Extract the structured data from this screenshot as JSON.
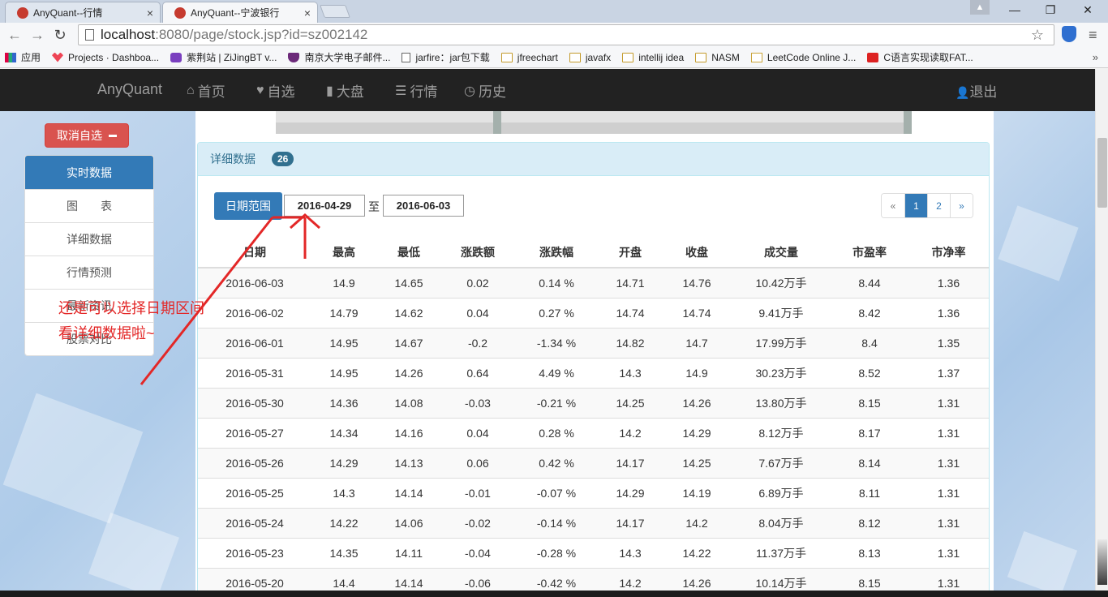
{
  "browser": {
    "tabs": [
      {
        "title": "AnyQuant--行情",
        "close": "×"
      },
      {
        "title": "AnyQuant--宁波银行",
        "close": "×"
      }
    ],
    "window_controls": {
      "minimize": "—",
      "restore": "❐",
      "close": "✕"
    },
    "nav": {
      "back": "←",
      "forward": "→",
      "reload": "↻"
    },
    "url_host": "localhost",
    "url_path": ":8080/page/stock.jsp?id=sz002142",
    "star": "☆",
    "menu": "≡",
    "bookmarks": [
      {
        "label": "应用",
        "icon": "grid"
      },
      {
        "label": "Projects · Dashboa...",
        "icon": "fox"
      },
      {
        "label": "紫荆站 | ZiJingBT v...",
        "icon": "purple"
      },
      {
        "label": "南京大学电子邮件...",
        "icon": "shield"
      },
      {
        "label": "jarfire：jar包下载",
        "icon": "doc"
      },
      {
        "label": "jfreechart",
        "icon": "folder"
      },
      {
        "label": "javafx",
        "icon": "folder"
      },
      {
        "label": "intellij idea",
        "icon": "folder"
      },
      {
        "label": "NASM",
        "icon": "folder"
      },
      {
        "label": "LeetCode Online J...",
        "icon": "lc"
      },
      {
        "label": "C语言实现读取FAT...",
        "icon": "red"
      }
    ],
    "bookmarks_more": "»"
  },
  "appnav": {
    "brand": "AnyQuant",
    "items": [
      {
        "icon": "⌂",
        "label": "首页"
      },
      {
        "icon": "♥",
        "label": "自选"
      },
      {
        "icon": "▮",
        "label": "大盘"
      },
      {
        "icon": "☰",
        "label": "行情"
      },
      {
        "icon": "◷",
        "label": "历史"
      }
    ],
    "logout_icon": "👤",
    "logout": "退出"
  },
  "sidebar": {
    "unfollow": "取消自选",
    "items": [
      "实时数据",
      "图　　表",
      "详细数据",
      "行情预测",
      "最新资讯",
      "股票对比"
    ]
  },
  "annotation": "还是可以选择日期区间看详细数据啦~",
  "panel": {
    "title": "详细数据",
    "badge": "26",
    "date_button": "日期范围",
    "date_from": "2016-04-29",
    "date_sep": "至",
    "date_to": "2016-06-03",
    "pager": {
      "prev": "«",
      "pages": [
        "1",
        "2"
      ],
      "active": "1",
      "next": "»"
    }
  },
  "table": {
    "columns": [
      "日期",
      "最高",
      "最低",
      "涨跌额",
      "涨跌幅",
      "开盘",
      "收盘",
      "成交量",
      "市盈率",
      "市净率"
    ],
    "rows": [
      {
        "date": "2016-06-03",
        "high": "14.9",
        "low": "14.65",
        "change": "0.02",
        "pct": "0.14 %",
        "open": "14.71",
        "close": "14.76",
        "volume": "10.42万手",
        "pe": "8.44",
        "pb": "1.36",
        "dir": "up"
      },
      {
        "date": "2016-06-02",
        "high": "14.79",
        "low": "14.62",
        "change": "0.04",
        "pct": "0.27 %",
        "open": "14.74",
        "close": "14.74",
        "volume": "9.41万手",
        "pe": "8.42",
        "pb": "1.36",
        "dir": "up"
      },
      {
        "date": "2016-06-01",
        "high": "14.95",
        "low": "14.67",
        "change": "-0.2",
        "pct": "-1.34 %",
        "open": "14.82",
        "close": "14.7",
        "volume": "17.99万手",
        "pe": "8.4",
        "pb": "1.35",
        "dir": "down"
      },
      {
        "date": "2016-05-31",
        "high": "14.95",
        "low": "14.26",
        "change": "0.64",
        "pct": "4.49 %",
        "open": "14.3",
        "close": "14.9",
        "volume": "30.23万手",
        "pe": "8.52",
        "pb": "1.37",
        "dir": "up"
      },
      {
        "date": "2016-05-30",
        "high": "14.36",
        "low": "14.08",
        "change": "-0.03",
        "pct": "-0.21 %",
        "open": "14.25",
        "close": "14.26",
        "volume": "13.80万手",
        "pe": "8.15",
        "pb": "1.31",
        "dir": "down"
      },
      {
        "date": "2016-05-27",
        "high": "14.34",
        "low": "14.16",
        "change": "0.04",
        "pct": "0.28 %",
        "open": "14.2",
        "close": "14.29",
        "volume": "8.12万手",
        "pe": "8.17",
        "pb": "1.31",
        "dir": "up"
      },
      {
        "date": "2016-05-26",
        "high": "14.29",
        "low": "14.13",
        "change": "0.06",
        "pct": "0.42 %",
        "open": "14.17",
        "close": "14.25",
        "volume": "7.67万手",
        "pe": "8.14",
        "pb": "1.31",
        "dir": "up"
      },
      {
        "date": "2016-05-25",
        "high": "14.3",
        "low": "14.14",
        "change": "-0.01",
        "pct": "-0.07 %",
        "open": "14.29",
        "close": "14.19",
        "volume": "6.89万手",
        "pe": "8.11",
        "pb": "1.31",
        "dir": "down"
      },
      {
        "date": "2016-05-24",
        "high": "14.22",
        "low": "14.06",
        "change": "-0.02",
        "pct": "-0.14 %",
        "open": "14.17",
        "close": "14.2",
        "volume": "8.04万手",
        "pe": "8.12",
        "pb": "1.31",
        "dir": "down"
      },
      {
        "date": "2016-05-23",
        "high": "14.35",
        "low": "14.11",
        "change": "-0.04",
        "pct": "-0.28 %",
        "open": "14.3",
        "close": "14.22",
        "volume": "11.37万手",
        "pe": "8.13",
        "pb": "1.31",
        "dir": "down"
      },
      {
        "date": "2016-05-20",
        "high": "14.4",
        "low": "14.14",
        "change": "-0.06",
        "pct": "-0.42 %",
        "open": "14.2",
        "close": "14.26",
        "volume": "10.14万手",
        "pe": "8.15",
        "pb": "1.31",
        "dir": "down"
      }
    ]
  },
  "colors": {
    "up": "#d21f1f",
    "down": "#198a2b",
    "accent": "#337ab7",
    "annotation": "#e32727"
  }
}
